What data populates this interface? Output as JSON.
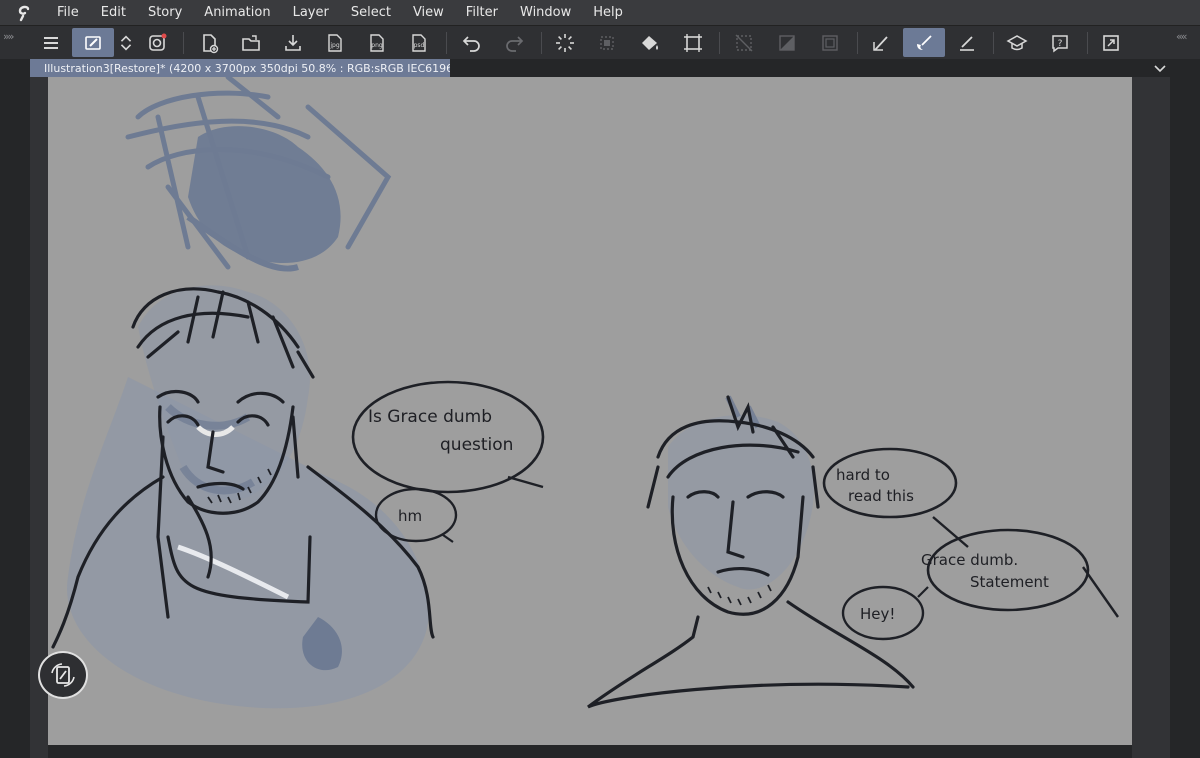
{
  "menu": {
    "items": [
      "File",
      "Edit",
      "Story",
      "Animation",
      "Layer",
      "Select",
      "View",
      "Filter",
      "Window",
      "Help"
    ]
  },
  "toolbar": {
    "buttons": [
      {
        "name": "main-menu-icon"
      },
      {
        "name": "user-assist-icon",
        "active": true
      },
      {
        "name": "toggle-arrows-icon"
      },
      {
        "name": "clip-studio-icon"
      },
      {
        "name": "new-canvas-icon"
      },
      {
        "name": "open-file-icon"
      },
      {
        "name": "save-icon"
      },
      {
        "name": "export-jpg-icon",
        "label": "jpg"
      },
      {
        "name": "export-png-icon",
        "label": "png"
      },
      {
        "name": "export-psd-icon",
        "label": "psd"
      },
      {
        "name": "undo-icon"
      },
      {
        "name": "redo-icon"
      },
      {
        "name": "loading-icon"
      },
      {
        "name": "transform-disabled-icon"
      },
      {
        "name": "fill-icon"
      },
      {
        "name": "crop-icon"
      },
      {
        "name": "hide-selection-icon"
      },
      {
        "name": "gradient-icon"
      },
      {
        "name": "selection-frame-icon"
      },
      {
        "name": "pen-tool-icon"
      },
      {
        "name": "brush-tool-icon",
        "active": true
      },
      {
        "name": "ruler-pen-icon"
      },
      {
        "name": "learn-icon"
      },
      {
        "name": "help-icon"
      },
      {
        "name": "fullscreen-icon"
      }
    ]
  },
  "document": {
    "tab_title": "Illustration3[Restore]* (4200 x 3700px 350dpi 50.8% : RGB:sRGB IEC61966-2.1)"
  },
  "canvas": {
    "background": "#9e9e9e",
    "sketch_color": "#1e2026",
    "shade_color": "#6e7b93",
    "speech_bubbles": [
      {
        "lines": [
          "Is Grace dumb",
          "question"
        ]
      },
      {
        "lines": [
          "hm"
        ]
      },
      {
        "lines": [
          "hard to",
          "read this"
        ]
      },
      {
        "lines": [
          "Grace dumb.",
          "Statement"
        ]
      },
      {
        "lines": [
          "Hey!"
        ]
      }
    ]
  },
  "colors": {
    "accent": "#6c7a96",
    "menubar": "#3a3b3e",
    "toolbar": "#2f3033"
  }
}
